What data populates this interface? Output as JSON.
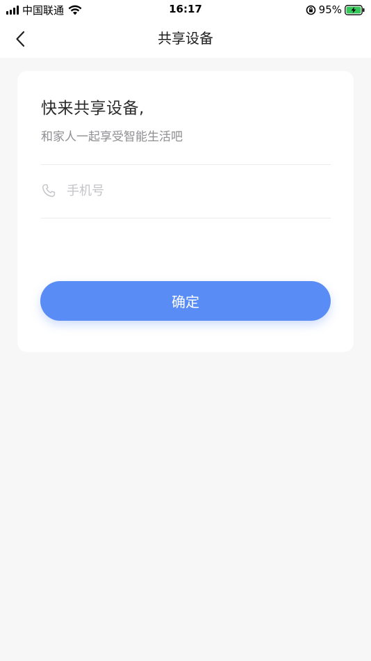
{
  "status_bar": {
    "carrier": "中国联通",
    "time": "16:17",
    "battery_percent": "95%",
    "signal_icon": "signal-bars-icon",
    "wifi_icon": "wifi-icon",
    "rotation_lock_icon": "rotation-lock-icon",
    "battery_icon": "battery-charging-icon"
  },
  "navbar": {
    "title": "共享设备",
    "back_icon": "chevron-left-icon"
  },
  "card": {
    "title": "快来共享设备,",
    "subtitle": "和家人一起享受智能生活吧",
    "phone_field": {
      "placeholder": "手机号",
      "value": "",
      "icon": "phone-icon"
    },
    "confirm_label": "确定"
  },
  "colors": {
    "background": "#f7f7f7",
    "card": "#ffffff",
    "primary": "#5a8cf5",
    "battery_green": "#34c759",
    "placeholder": "#c4c4c8",
    "subtitle": "#8e8e93"
  }
}
